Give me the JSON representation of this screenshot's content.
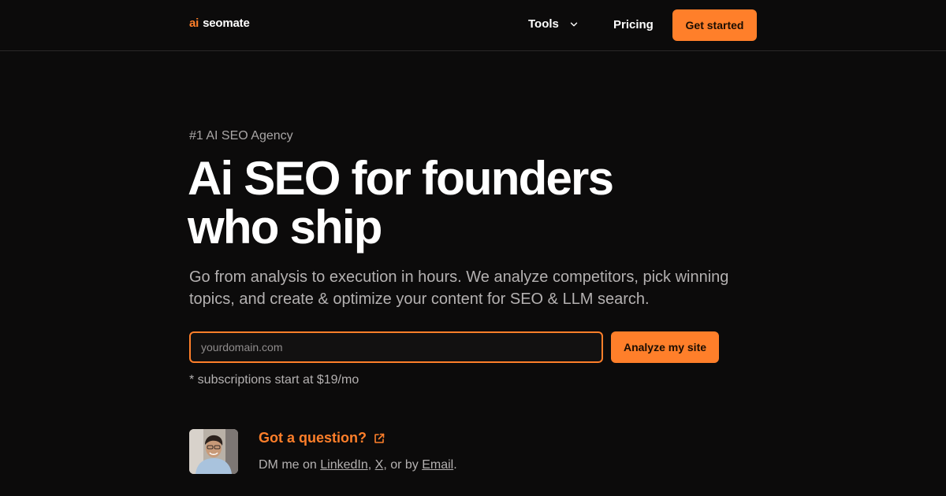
{
  "header": {
    "logo_ai": "ai",
    "logo_name": "seomate",
    "nav_tools": "Tools",
    "nav_pricing": "Pricing",
    "cta": "Get started"
  },
  "hero": {
    "eyebrow": "#1 AI SEO Agency",
    "headline_line1": "Ai SEO for founders",
    "headline_line2": "who ship",
    "subline": "Go from analysis to execution in hours. We analyze competitors, pick winning topics, and create & optimize your content for SEO & LLM search.",
    "input_placeholder": "yourdomain.com",
    "input_value": "",
    "analyze_button": "Analyze my site",
    "footnote": "* subscriptions start at $19/mo"
  },
  "contact": {
    "question": "Got a question?",
    "dm_prefix": "DM me on ",
    "link_linkedin": "LinkedIn",
    "sep1": ", ",
    "link_x": "X",
    "sep2": ", or by ",
    "link_email": "Email",
    "suffix": "."
  },
  "colors": {
    "accent": "#ff7f2a",
    "background": "#0c0b0b",
    "text_muted": "#b4b1b1"
  },
  "icons": {
    "tools_dropdown": "chevron-down-icon",
    "question_link": "external-link-icon"
  }
}
